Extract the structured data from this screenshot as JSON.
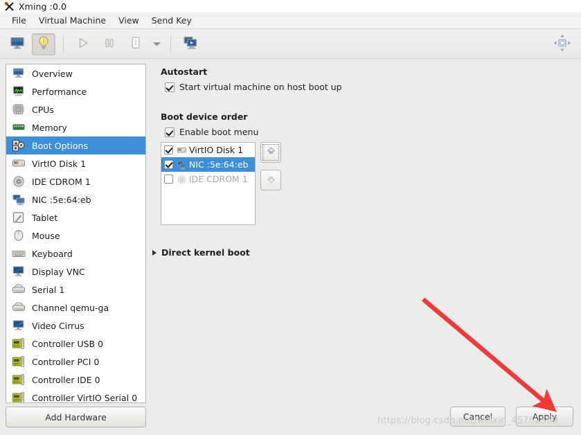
{
  "window": {
    "title": "Xming :0.0",
    "logo_icon": "xming-x-icon"
  },
  "menubar": {
    "items": [
      {
        "label": "File",
        "name": "menu-file"
      },
      {
        "label": "Virtual Machine",
        "name": "menu-virtual-machine"
      },
      {
        "label": "View",
        "name": "menu-view"
      },
      {
        "label": "Send Key",
        "name": "menu-send-key"
      }
    ]
  },
  "toolbar": {
    "buttons": [
      {
        "icon": "console-monitor-icon",
        "name": "show-graphical-console-button",
        "state": "normal"
      },
      {
        "icon": "lightbulb-icon",
        "name": "show-virtual-hardware-details-button",
        "state": "active"
      },
      {
        "icon": "play-triangle-icon",
        "name": "run-button",
        "state": "disabled"
      },
      {
        "icon": "pause-bars-icon",
        "name": "pause-button",
        "state": "disabled"
      },
      {
        "icon": "shutdown-icon",
        "name": "shutdown-button",
        "state": "normal"
      },
      {
        "icon": "chevron-down-icon",
        "name": "shutdown-options-dropdown",
        "state": "normal"
      },
      {
        "icon": "snapshots-icon",
        "name": "manage-snapshots-button",
        "state": "normal"
      }
    ],
    "right_button": {
      "icon": "fullscreen-resize-icon",
      "name": "resize-to-vm-button"
    }
  },
  "sidebar": {
    "items": [
      {
        "label": "Overview",
        "icon": "monitor-icon",
        "selected": false
      },
      {
        "label": "Performance",
        "icon": "graph-icon",
        "selected": false
      },
      {
        "label": "CPUs",
        "icon": "cpu-chip-icon",
        "selected": false
      },
      {
        "label": "Memory",
        "icon": "memory-stick-icon",
        "selected": false
      },
      {
        "label": "Boot Options",
        "icon": "boot-gears-icon",
        "selected": true
      },
      {
        "label": "VirtIO Disk 1",
        "icon": "harddisk-icon",
        "selected": false
      },
      {
        "label": "IDE CDROM 1",
        "icon": "cdrom-disc-icon",
        "selected": false
      },
      {
        "label": "NIC :5e:64:eb",
        "icon": "network-card-icon",
        "selected": false
      },
      {
        "label": "Tablet",
        "icon": "tablet-pen-icon",
        "selected": false
      },
      {
        "label": "Mouse",
        "icon": "mouse-icon",
        "selected": false
      },
      {
        "label": "Keyboard",
        "icon": "keyboard-icon",
        "selected": false
      },
      {
        "label": "Display VNC",
        "icon": "display-icon",
        "selected": false
      },
      {
        "label": "Serial 1",
        "icon": "serial-port-icon",
        "selected": false
      },
      {
        "label": "Channel qemu-ga",
        "icon": "channel-icon",
        "selected": false
      },
      {
        "label": "Video Cirrus",
        "icon": "video-card-icon",
        "selected": false
      },
      {
        "label": "Controller USB 0",
        "icon": "controller-card-icon",
        "selected": false
      },
      {
        "label": "Controller PCI 0",
        "icon": "controller-card-icon",
        "selected": false
      },
      {
        "label": "Controller IDE 0",
        "icon": "controller-card-icon",
        "selected": false
      },
      {
        "label": "Controller VirtIO Serial 0",
        "icon": "controller-card-icon",
        "selected": false
      }
    ],
    "add_hardware_label": "Add Hardware"
  },
  "main": {
    "autostart": {
      "title": "Autostart",
      "checkbox_label": "Start virtual machine on host boot up",
      "checked": true
    },
    "boot_order": {
      "title": "Boot device order",
      "enable_boot_menu_label": "Enable boot menu",
      "enable_boot_menu_checked": true,
      "devices": [
        {
          "label": "VirtIO Disk 1",
          "icon": "harddisk-icon",
          "checked": true,
          "selected": false,
          "enabled": true
        },
        {
          "label": "NIC :5e:64:eb",
          "icon": "network-card-icon",
          "checked": true,
          "selected": true,
          "enabled": true
        },
        {
          "label": "IDE CDROM 1",
          "icon": "cdrom-disc-icon",
          "checked": false,
          "selected": false,
          "enabled": false
        }
      ],
      "move_up_icon": "arrow-up-icon",
      "move_down_icon": "arrow-down-icon"
    },
    "direct_kernel_boot": {
      "label": "Direct kernel boot",
      "expanded": false,
      "icon": "expander-triangle-icon"
    }
  },
  "footer": {
    "cancel_label": "Cancel",
    "apply_label": "Apply"
  },
  "watermark": {
    "text": "https://blog.csdn.net/weixin_45762569"
  },
  "annotation": {
    "arrow_color": "#ef3b38",
    "points_to": "apply-button"
  },
  "colors": {
    "selection_blue": "#3d8fd8",
    "window_bg": "#ececeb",
    "panel_white": "#ffffff",
    "accent_red": "#ef3b38"
  }
}
